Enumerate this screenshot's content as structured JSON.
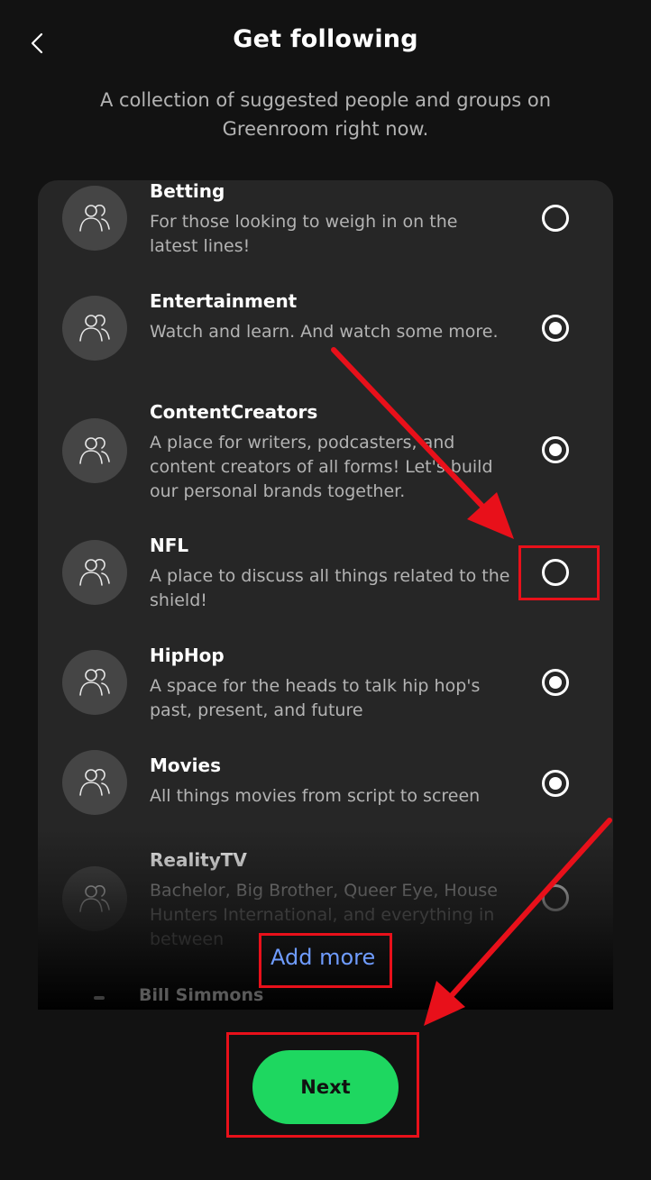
{
  "header": {
    "title": "Get following",
    "subtitle": "A collection of suggested people and groups on Greenroom right now."
  },
  "list": {
    "items": [
      {
        "title": "Betting",
        "description": "For those looking to weigh in on the latest lines!",
        "selected": false
      },
      {
        "title": "Entertainment",
        "description": "Watch and learn. And watch some more.",
        "selected": true
      },
      {
        "title": "ContentCreators",
        "description": "A place for writers, podcasters, and content creators of all forms! Let's build our personal brands together.",
        "selected": true
      },
      {
        "title": "NFL",
        "description": "A place to discuss all things related to the shield!",
        "selected": false
      },
      {
        "title": "HipHop",
        "description": "A space for the heads to talk hip hop's past, present, and future",
        "selected": true
      },
      {
        "title": "Movies",
        "description": "All things movies from script to screen",
        "selected": true
      },
      {
        "title": "RealityTV",
        "description": "Bachelor, Big Brother, Queer Eye, House Hunters International, and everything in between",
        "selected": false
      }
    ],
    "peek_item": "Bill Simmons",
    "add_more_label": "Add more"
  },
  "footer": {
    "next_label": "Next"
  },
  "colors": {
    "accent": "#1ed760",
    "link": "#6f9cff",
    "highlight": "#e8101a"
  },
  "icons": {
    "back": "chevron-left-icon",
    "group": "people-group-icon"
  }
}
